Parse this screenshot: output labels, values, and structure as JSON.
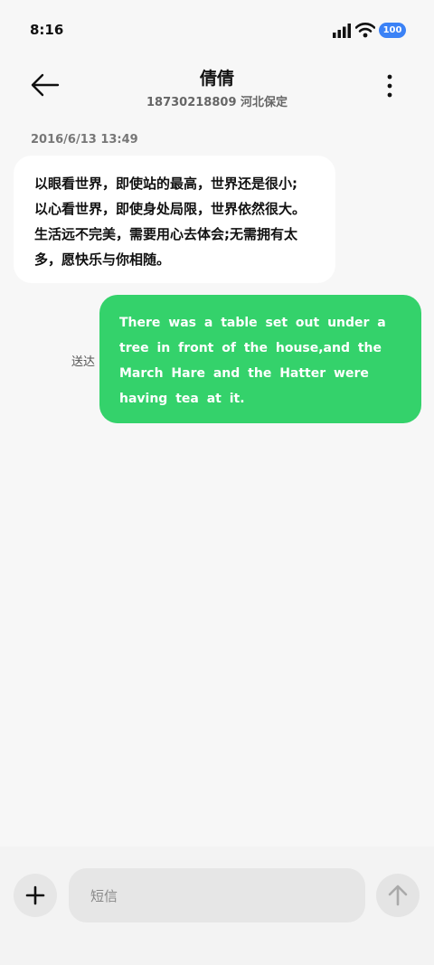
{
  "status_bar": {
    "time": "8:16",
    "battery": "100"
  },
  "header": {
    "contact_name": "倩倩",
    "contact_info": "18730218809  河北保定"
  },
  "conversation": {
    "timestamp": "2016/6/13  13:49",
    "incoming": {
      "lines": [
        "以眼看世界，即使站的最高，世界还是很小;",
        "以心看世界，即使身处局限，世界依然很大。",
        "生活远不完美，需要用心去体会;无需拥有太",
        "多，愿快乐与你相随。"
      ]
    },
    "outgoing": {
      "lines": [
        "There was a table set out under a",
        "tree in front of the house,and the",
        "March Hare and the Hatter were",
        "having tea at it."
      ],
      "status": "送达"
    }
  },
  "composer": {
    "placeholder": "短信"
  },
  "icons": [
    "signal-icon",
    "wifi-icon",
    "back-arrow-icon",
    "more-options-icon",
    "plus-icon",
    "send-arrow-icon"
  ],
  "colors": {
    "outgoing_bubble": "#34d26b",
    "battery_badge": "#3b82f6"
  }
}
